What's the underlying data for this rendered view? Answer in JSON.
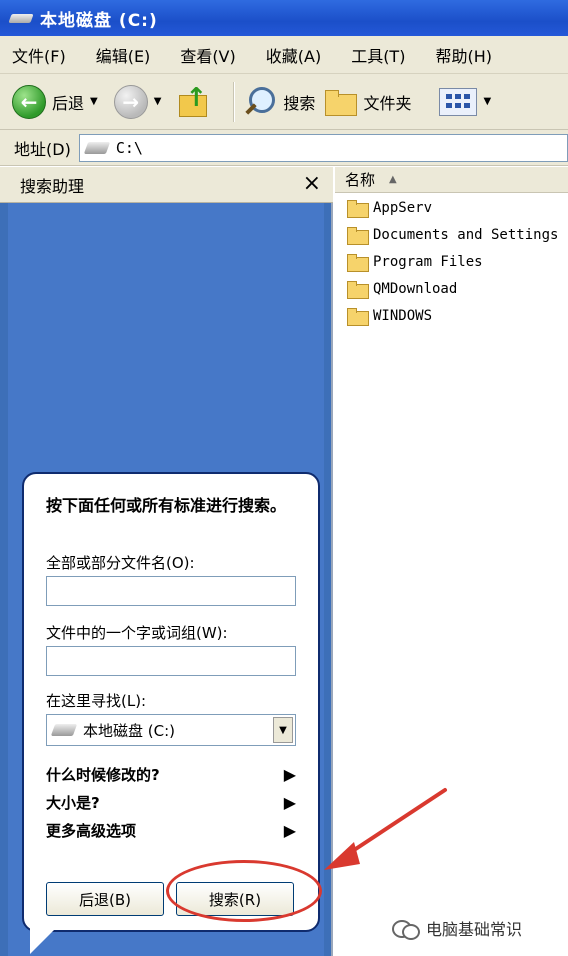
{
  "window": {
    "title": "本地磁盘 (C:)"
  },
  "menu": [
    "文件(F)",
    "编辑(E)",
    "查看(V)",
    "收藏(A)",
    "工具(T)",
    "帮助(H)"
  ],
  "toolbar": {
    "back": "后退",
    "search": "搜索",
    "folders": "文件夹"
  },
  "address": {
    "label": "地址(D)",
    "value": "C:\\"
  },
  "search_pane": {
    "title": "搜索助理",
    "instructions": "按下面任何或所有标准进行搜索。",
    "filename_label": "全部或部分文件名(O):",
    "filename_value": "",
    "phrase_label": "文件中的一个字或词组(W):",
    "phrase_value": "",
    "lookin_label": "在这里寻找(L):",
    "lookin_value": "本地磁盘 (C:)",
    "options": [
      "什么时候修改的?",
      "大小是?",
      "更多高级选项"
    ],
    "back_button": "后退(B)",
    "search_button": "搜索(R)"
  },
  "file_list": {
    "column_name": "名称",
    "files": [
      "AppServ",
      "Documents and Settings",
      "Program Files",
      "QMDownload",
      "WINDOWS"
    ]
  },
  "watermark": {
    "text": "电脑基础常识"
  },
  "colors": {
    "pane_blue": "#3d6fb8",
    "titlebar": "#1b4fc9",
    "annotation_red": "#d9392f"
  }
}
